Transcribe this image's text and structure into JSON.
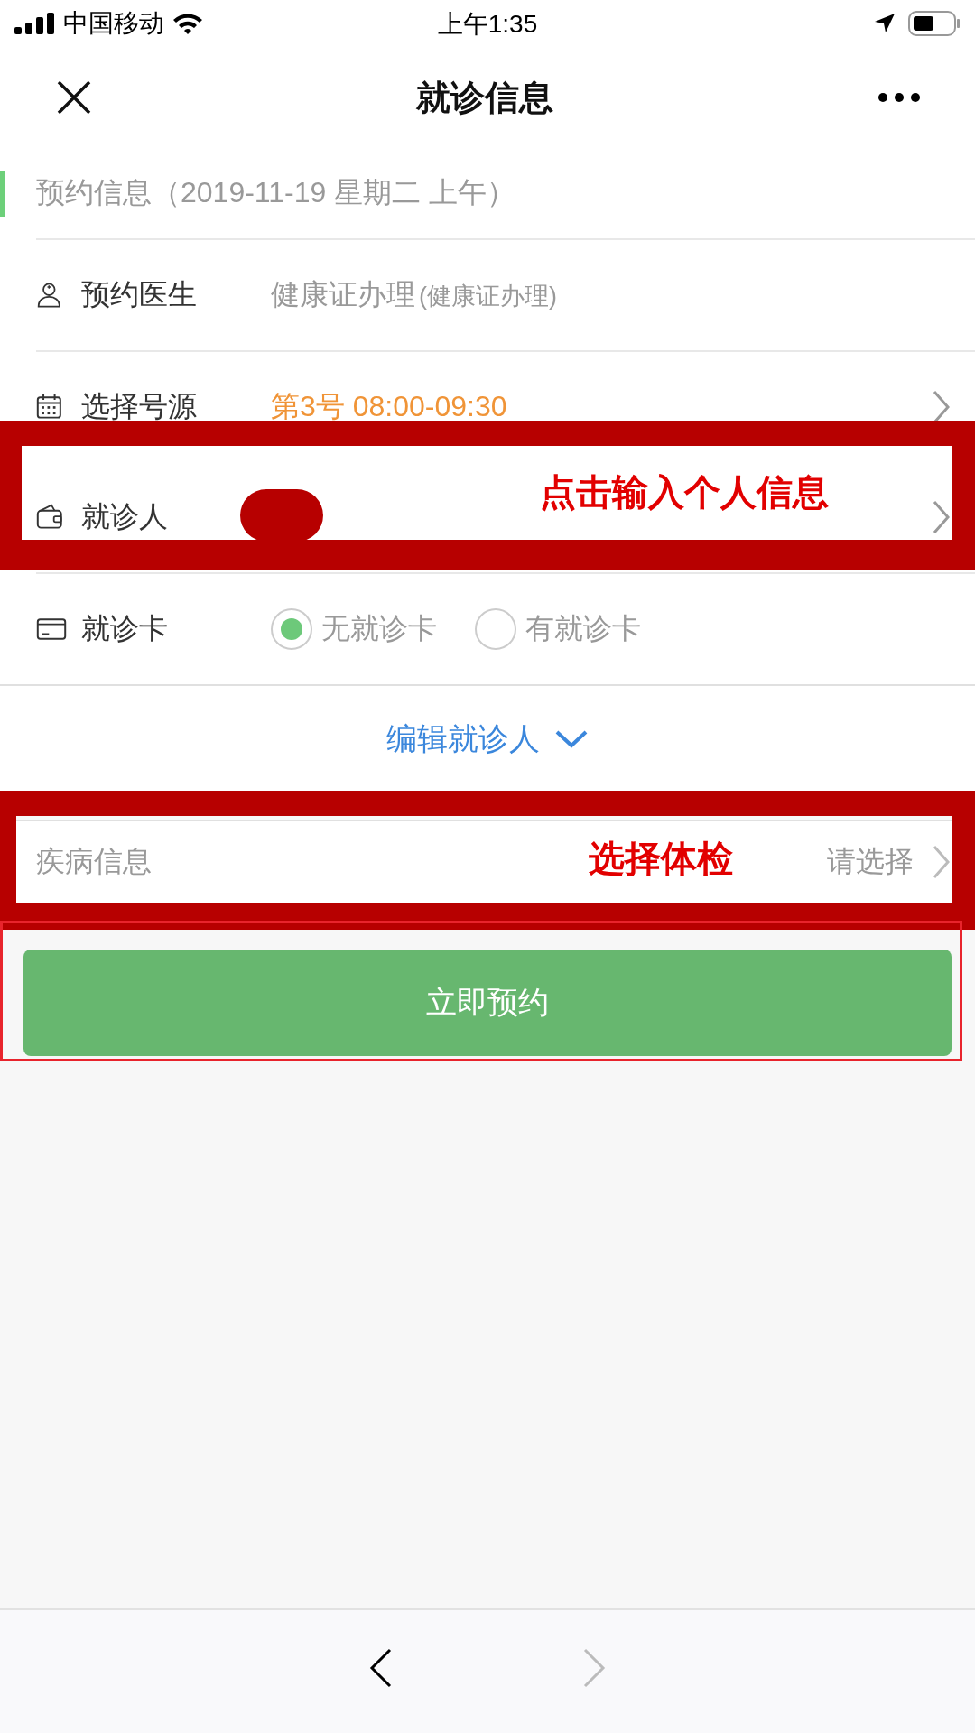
{
  "status_bar": {
    "carrier": "中国移动",
    "time": "上午1:35"
  },
  "nav": {
    "title": "就诊信息"
  },
  "section_header": "预约信息（2019-11-19 星期二 上午）",
  "rows": [
    {
      "kind": "text",
      "label": "预约医生",
      "value": "健康证办理",
      "note": "(健康证办理)"
    },
    {
      "kind": "link",
      "label": "选择号源",
      "value": "第3号 08:00-09:30"
    },
    {
      "kind": "link",
      "label": "就诊人",
      "redacted": true,
      "annotation": "点击输入个人信息"
    },
    {
      "kind": "radio",
      "label": "就诊卡",
      "options": [
        {
          "label": "无就诊卡",
          "selected": true
        },
        {
          "label": "有就诊卡",
          "selected": false
        }
      ]
    }
  ],
  "edit_link": "编辑就诊人",
  "disease": {
    "label": "疾病信息",
    "hint": "请选择",
    "annotation": "选择体检"
  },
  "submit_button": {
    "label": "立即预约",
    "outlined": true
  },
  "toolbar": {
    "back_disabled": false,
    "forward_disabled": true
  }
}
